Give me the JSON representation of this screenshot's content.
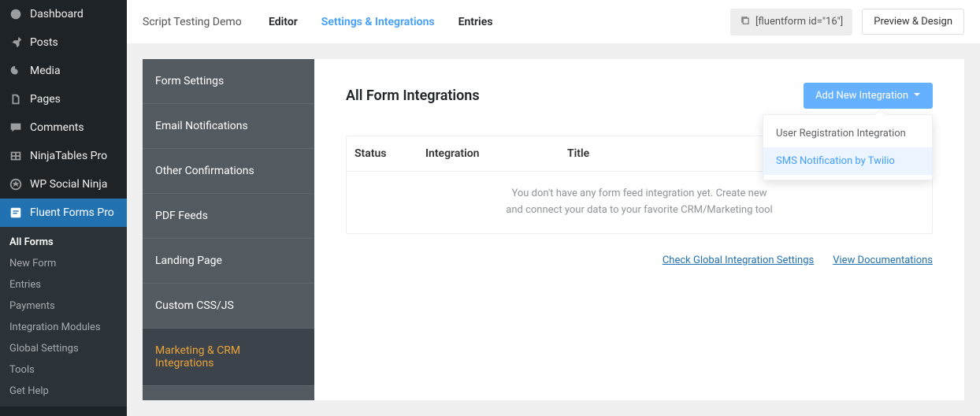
{
  "wp_menu": {
    "dashboard": "Dashboard",
    "posts": "Posts",
    "media": "Media",
    "pages": "Pages",
    "comments": "Comments",
    "ninjatables": "NinjaTables Pro",
    "socialninja": "WP Social Ninja",
    "fluentforms": "Fluent Forms Pro"
  },
  "wp_submenu": {
    "all_forms": "All Forms",
    "new_form": "New Form",
    "entries": "Entries",
    "payments": "Payments",
    "integration_modules": "Integration Modules",
    "global_settings": "Global Settings",
    "tools": "Tools",
    "get_help": "Get Help"
  },
  "topbar": {
    "form_title": "Script Testing Demo ...",
    "tab_editor": "Editor",
    "tab_settings": "Settings & Integrations",
    "tab_entries": "Entries",
    "shortcode": "[fluentform id=\"16\"]",
    "preview_btn": "Preview & Design"
  },
  "settings_sidebar": {
    "form_settings": "Form Settings",
    "email_notifications": "Email Notifications",
    "other_confirmations": "Other Confirmations",
    "pdf_feeds": "PDF Feeds",
    "landing_page": "Landing Page",
    "custom_css": "Custom CSS/JS",
    "marketing_crm": "Marketing & CRM Integrations"
  },
  "panel": {
    "title": "All Form Integrations",
    "add_btn": "Add New Integration",
    "col_status": "Status",
    "col_integration": "Integration",
    "col_title": "Title",
    "empty_text_line": "You don't have any form feed integration yet. Create new",
    "empty_text_line2": "and connect your data to your favorite CRM/Marketing tool",
    "link_global": "Check Global Integration Settings",
    "link_docs": "View Documentations"
  },
  "dropdown": {
    "item1": "User Registration Integration",
    "item2": "SMS Notification by Twilio"
  }
}
